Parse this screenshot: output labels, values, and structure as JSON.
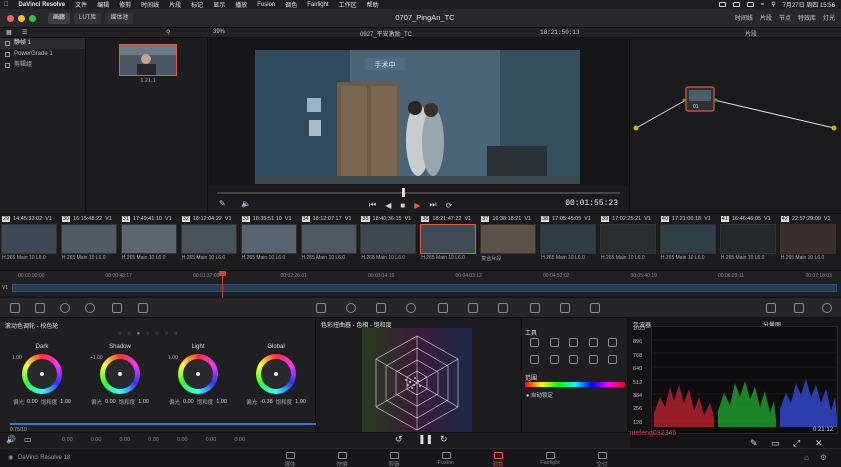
{
  "menubar": {
    "app_name": "DaVinci Resolve",
    "items": [
      "文件",
      "编辑",
      "修剪",
      "时间线",
      "片段",
      "标记",
      "显示",
      "播放",
      "Fusion",
      "调色",
      "Fairlight",
      "工作区",
      "帮助"
    ],
    "clock": "7月27日 周四 15:56"
  },
  "titlebar": {
    "tabs": [
      "画廊",
      "LUT库",
      "媒体池"
    ],
    "project_title": "0707_PingAn_TC",
    "right_buttons": [
      "时间线",
      "片段",
      "节点",
      "特效库",
      "灯光"
    ]
  },
  "toolbar": {
    "zoom": "39%",
    "viewer_title": "0927_平安激励_TC",
    "timecode_top": "18:21:50:13",
    "node_mode": "片段"
  },
  "gallery": {
    "albums": [
      "静帧 1",
      "PowerGrade 1",
      "剪辑组"
    ],
    "still_label": "1.21.1"
  },
  "viewer": {
    "door_sign": "手术中",
    "timecode": "00:01:55:23"
  },
  "nodes": {
    "node_label": "01"
  },
  "clips": [
    {
      "num": "29",
      "tc": "14:45:33:02",
      "track": "V1",
      "codec": "H.265 Main 10 L6.0",
      "color": "#3d4a55"
    },
    {
      "num": "30",
      "tc": "16:15:48:22",
      "track": "V1",
      "codec": "H.265 Main 10 L6.0",
      "color": "#4f5a62"
    },
    {
      "num": "31",
      "tc": "17:49:41:10",
      "track": "V1",
      "codec": "H.265 Main 10 L6.0",
      "color": "#5a6670"
    },
    {
      "num": "32",
      "tc": "18:12:04:22",
      "track": "V1",
      "codec": "H.265 Main 10 L6.0",
      "color": "#46525c"
    },
    {
      "num": "33",
      "tc": "18:35:51:10",
      "track": "V1",
      "codec": "H.265 Main 10 L6.0",
      "color": "#566570"
    },
    {
      "num": "34",
      "tc": "18:12:07:17",
      "track": "V1",
      "codec": "H.265 Main 10 L6.0",
      "color": "#4d5963"
    },
    {
      "num": "35",
      "tc": "18:40:36:15",
      "track": "V1",
      "codec": "H.265 Main 10 L6.0",
      "color": "#3c4852"
    },
    {
      "num": "36",
      "tc": "18:21:47:22",
      "track": "V1",
      "codec": "H.265 Main 10 L6.0",
      "color": "#3f4c57"
    },
    {
      "num": "37",
      "tc": "16:38:18:21",
      "track": "V1",
      "codec": "复合片段",
      "color": "#5c5248"
    },
    {
      "num": "38",
      "tc": "17:05:45:05",
      "track": "V1",
      "codec": "H.265 Main 10 L6.0",
      "color": "#2f3d46"
    },
    {
      "num": "39",
      "tc": "17:02:25:21",
      "track": "V1",
      "codec": "H.265 Main 10 L6.0",
      "color": "#2b2e30"
    },
    {
      "num": "40",
      "tc": "17:21:00:18",
      "track": "V1",
      "codec": "H.265 Main 10 L6.0",
      "color": "#2d4048"
    },
    {
      "num": "41",
      "tc": "16:46:46:05",
      "track": "V1",
      "codec": "H.265 Main 10 L6.0",
      "color": "#24282b"
    },
    {
      "num": "42",
      "tc": "22:57:29:09",
      "track": "V1",
      "codec": "H.265 Main 10 L6.0",
      "color": "#3b2f2a"
    }
  ],
  "ruler": {
    "ticks": [
      "00:00:00:00",
      "00:00:48:17",
      "00:01:37:09",
      "00:02:26:01",
      "00:03:14:19",
      "00:04:03:12",
      "00:04:52:02",
      "00:05:40:19",
      "00:06:29:11",
      "00:07:18:03"
    ],
    "track_label": "V1"
  },
  "wheels": {
    "title": "滚动色调轮 - 校色轮",
    "items": [
      {
        "name": "Dark",
        "value_top": "1.00",
        "a_label": "偏光",
        "a": "0.00",
        "b_label": "饱和度",
        "b": "1.00",
        "color": "#aaaaaa"
      },
      {
        "name": "Shadow",
        "value_top": "+1.00",
        "a_label": "偏光",
        "a": "0.00",
        "b_label": "饱和度",
        "b": "1.00",
        "color": "#aaaaaa"
      },
      {
        "name": "Light",
        "value_top": "1.00",
        "a_label": "偏光",
        "a": "0.00",
        "b_label": "饱和度",
        "b": "1.00",
        "color": "#aaaaaa"
      },
      {
        "name": "Global",
        "value_top": "",
        "a_label": "偏光",
        "a": "-0.38",
        "b_label": "饱和度",
        "b": "1.00",
        "color": "#aaaaaa"
      }
    ],
    "slider_value": "0.75/10",
    "footer": [
      "0.00",
      "0.00",
      "0.00",
      "0.00",
      "0.00",
      "0.00",
      "0.00"
    ]
  },
  "vectorscope": {
    "title": "色彩扭曲器 - 色相 - 饱和度"
  },
  "tools": {
    "title": "工具",
    "section": "范围",
    "option": "自动锁定"
  },
  "scope": {
    "title": "示波器",
    "mode": "分量图",
    "y_labels": [
      "1023",
      "896",
      "768",
      "640",
      "512",
      "384",
      "256",
      "128"
    ],
    "timecode": "0:21:12",
    "watermark": "xuefeng032345"
  },
  "pagebar": {
    "app_label": "DaVinci Resolve 18",
    "pages": [
      "媒体",
      "快编",
      "剪辑",
      "Fusion",
      "调色",
      "Fairlight",
      "交付"
    ],
    "active": "调色"
  }
}
